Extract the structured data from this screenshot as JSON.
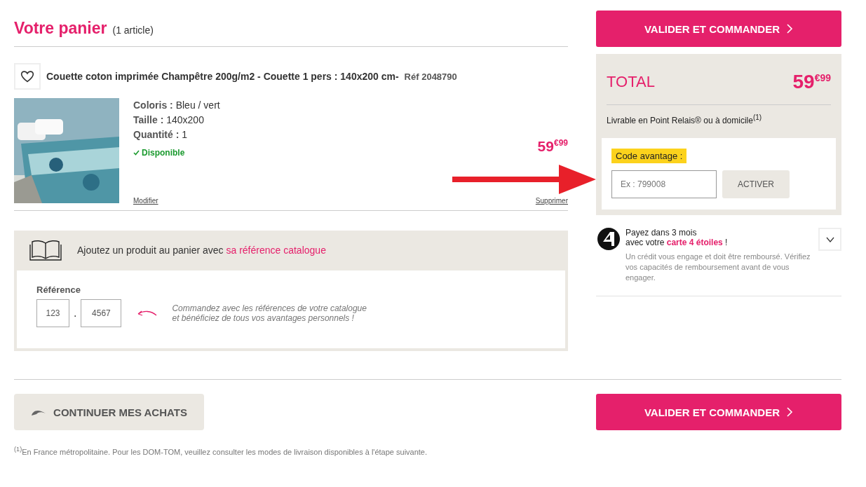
{
  "cart": {
    "title": "Votre panier",
    "count": "(1 article)"
  },
  "item": {
    "favorite": false,
    "name": "Couette coton imprimée Champêtre 200g/m2 - Couette 1 pers : 140x200 cm-",
    "ref": "Réf 2048790",
    "attributes": [
      {
        "label": "Coloris :",
        "value": "Bleu / vert"
      },
      {
        "label": "Taille :",
        "value": "140x200"
      },
      {
        "label": "Quantité :",
        "value": "1"
      }
    ],
    "availability": "Disponible",
    "price": "59$^{€99}$",
    "edit": "Modifier",
    "remove": "Supprimer"
  },
  "catalog": {
    "text": "Ajoutez un produit au panier avec",
    "link": "sa référence catalogue",
    "label": "Référence",
    "field_1": "123",
    "separator": ".",
    "field_2": "4567",
    "hint": "Commandez avec les références de votre catalogue\net bénéficiez de tous vos avantages personnels !"
  },
  "checkout_top": "VALIDER ET COMMANDER",
  "summary": {
    "total_label": "TOTAL",
    "total": "59$^{€99}$",
    "delivery": "Livrable en Point Relais® ou à domicile$^{(1)}$",
    "code_label": "Code avantage :",
    "code_placeholder": "Ex : 799008",
    "activate": "ACTIVER"
  },
  "financing": {
    "line_1": "Payez dans 3 mois",
    "line_2": "avec votre **carte 4 étoiles** !",
    "note": "Un crédit vous engage et doit être remboursé. Vérifiez vos capacités de remboursement avant de vous engager.",
    "expanded": false
  },
  "continue": "CONTINUER MES ACHATS",
  "checkout_bottom": "VALIDER ET COMMANDER",
  "footnote": "$^{(1)}$En France métropolitaine. Pour les DOM-TOM, veuillez consulter les modes de livraison disponibles à l'étape suivante."
}
